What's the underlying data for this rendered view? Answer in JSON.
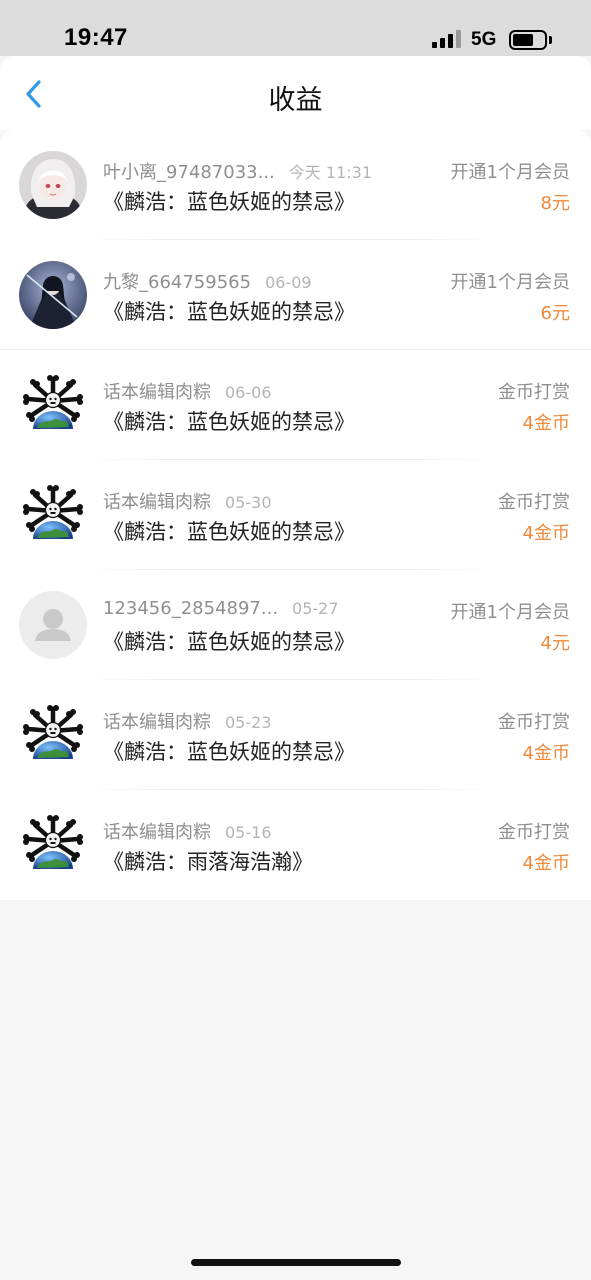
{
  "status_bar": {
    "time": "19:47",
    "network": "5G",
    "signal_bars": 3,
    "battery_level": 0.65
  },
  "header": {
    "title": "收益",
    "back_icon": "chevron-left-icon"
  },
  "records": [
    {
      "user": "叶小离_97487033...",
      "date": "今天 11:31",
      "book": "《麟浩：蓝色妖姬的禁忌》",
      "type": "开通1个月会员",
      "amount": "8元",
      "avatar": "anime-girl-white-hair"
    },
    {
      "user": "九黎_664759565",
      "date": "06-09",
      "book": "《麟浩：蓝色妖姬的禁忌》",
      "type": "开通1个月会员",
      "amount": "6元",
      "avatar": "anime-swordsman"
    },
    {
      "user": "话本编辑肉粽",
      "date": "06-06",
      "book": "《麟浩：蓝色妖姬的禁忌》",
      "type": "金币打赏",
      "amount": "4金币",
      "avatar": "bone-globe"
    },
    {
      "user": "话本编辑肉粽",
      "date": "05-30",
      "book": "《麟浩：蓝色妖姬的禁忌》",
      "type": "金币打赏",
      "amount": "4金币",
      "avatar": "bone-globe"
    },
    {
      "user": "123456_2854897...",
      "date": "05-27",
      "book": "《麟浩：蓝色妖姬的禁忌》",
      "type": "开通1个月会员",
      "amount": "4元",
      "avatar": "default-person"
    },
    {
      "user": "话本编辑肉粽",
      "date": "05-23",
      "book": "《麟浩：蓝色妖姬的禁忌》",
      "type": "金币打赏",
      "amount": "4金币",
      "avatar": "bone-globe"
    },
    {
      "user": "话本编辑肉粽",
      "date": "05-16",
      "book": "《麟浩：雨落海浩瀚》",
      "type": "金币打赏",
      "amount": "4金币",
      "avatar": "bone-globe"
    }
  ],
  "colors": {
    "accent_blue": "#2f9be6",
    "amount_orange": "#ef8a3c",
    "muted_text": "#8f8f8f"
  }
}
